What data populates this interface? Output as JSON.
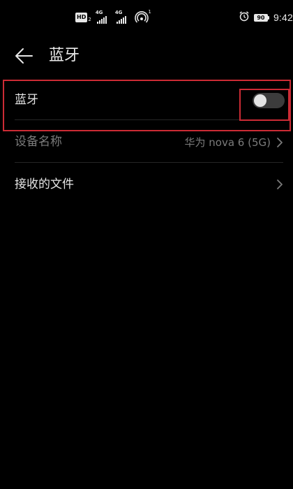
{
  "status_bar": {
    "hd_badge": "HD",
    "hd_sub": "2",
    "sim1_network": "4G",
    "sim2_network": "4G",
    "hotspot_count": "1",
    "battery_level": "90",
    "time": "9:42",
    "icons": [
      "hd-icon",
      "signal-icon",
      "signal-icon",
      "hotspot-icon",
      "alarm-icon",
      "battery-icon"
    ]
  },
  "header": {
    "title": "蓝牙",
    "back_icon": "back-arrow-icon"
  },
  "settings": {
    "bluetooth": {
      "label": "蓝牙",
      "enabled": false
    },
    "device_name": {
      "label": "设备名称",
      "value": "华为 nova 6 (5G)"
    },
    "received_files": {
      "label": "接收的文件"
    }
  },
  "colors": {
    "background": "#000000",
    "text_primary": "#e6e6e6",
    "text_secondary": "#7b7b7b",
    "divider": "#262626",
    "toggle_track_off": "#3c3c3c",
    "toggle_knob": "#e4e4e4",
    "highlight": "#cc2b35"
  }
}
